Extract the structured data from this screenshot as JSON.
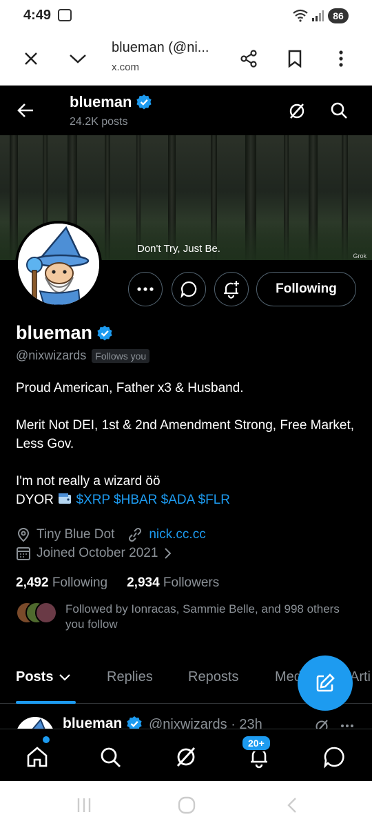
{
  "status": {
    "time": "4:49",
    "battery": "86"
  },
  "browser": {
    "title": "blueman (@ni...",
    "url": "x.com"
  },
  "header": {
    "name": "blueman",
    "posts_count": "24.2K posts"
  },
  "banner": {
    "tagline": "Don't Try, Just Be.",
    "watermark": "Grok"
  },
  "actions": {
    "following_label": "Following"
  },
  "profile": {
    "name": "blueman",
    "handle": "@nixwizards",
    "follows_you": "Follows you",
    "bio_line1": "Proud American, Father x3 & Husband.",
    "bio_line2": "Merit Not DEI, 1st & 2nd Amendment Strong, Free Market, Less Gov.",
    "bio_line3": "I'm not really a wizard öö",
    "bio_line4_prefix": "DYOR",
    "bio_cashtags": "$XRP $HBAR $ADA $FLR",
    "location": "Tiny Blue Dot",
    "website": "nick.cc.cc",
    "joined": "Joined October 2021",
    "following_count": "2,492",
    "following_label": "Following",
    "followers_count": "2,934",
    "followers_label": "Followers",
    "followed_by": "Followed by Ionracas, Sammie Belle, and 998 others you follow"
  },
  "tabs": [
    {
      "label": "Posts"
    },
    {
      "label": "Replies"
    },
    {
      "label": "Reposts"
    },
    {
      "label": "Media"
    },
    {
      "label": "Arti"
    }
  ],
  "post": {
    "name": "blueman",
    "meta": "@nixwizards · 23h"
  },
  "bottom_nav": {
    "notifications_badge": "20+"
  },
  "colors": {
    "accent": "#1d9bf0",
    "background": "#000000",
    "muted": "#8b9197"
  }
}
